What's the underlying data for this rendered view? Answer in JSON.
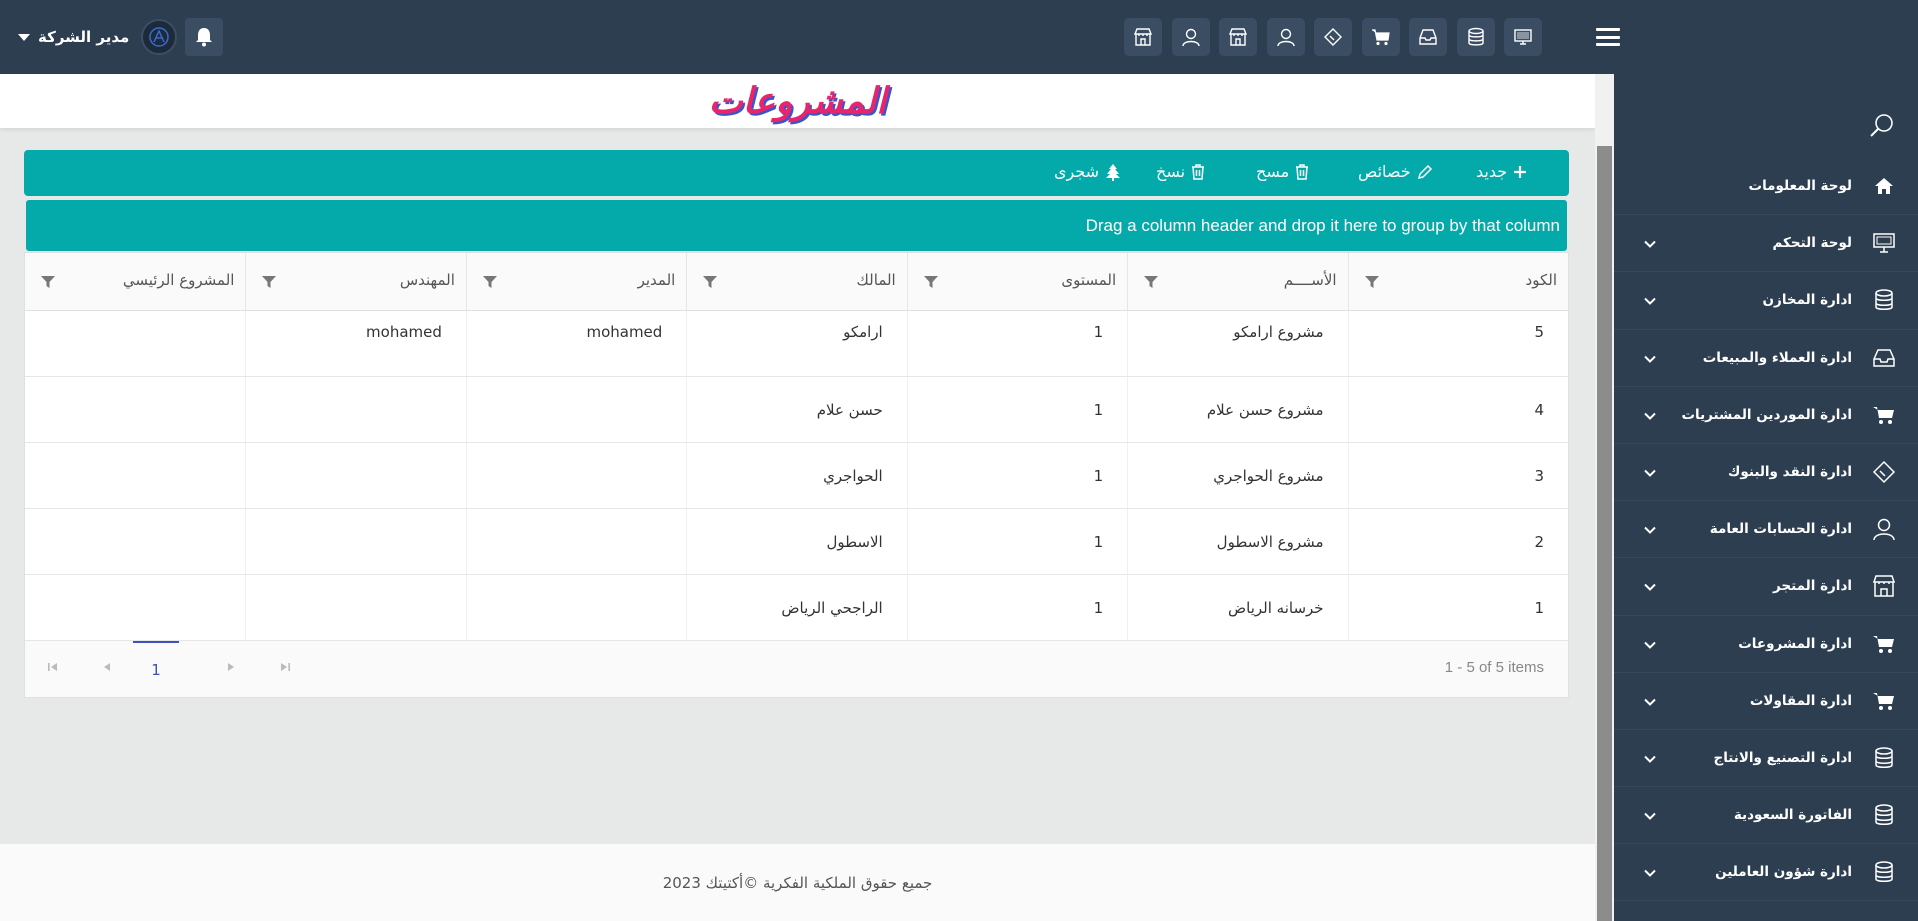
{
  "header": {
    "user_name": "مدير الشركة"
  },
  "toolbar_icons": [
    "store-icon",
    "user-icon",
    "store-icon",
    "user-icon",
    "ticket-icon",
    "cart-icon",
    "inbox-icon",
    "database-icon",
    "monitor-icon"
  ],
  "sidebar": {
    "items": [
      {
        "label": "لوحة المعلومات",
        "icon": "home-icon",
        "has_chevron": false
      },
      {
        "label": "لوحة التحكم",
        "icon": "monitor-icon",
        "has_chevron": true
      },
      {
        "label": "ادارة المخازن",
        "icon": "database-icon",
        "has_chevron": true
      },
      {
        "label": "ادارة العملاء والمبيعات",
        "icon": "inbox-icon",
        "has_chevron": true
      },
      {
        "label": "ادارة الموردين المشتريات",
        "icon": "cart-icon",
        "has_chevron": true
      },
      {
        "label": "ادارة النقد والبنوك",
        "icon": "ticket-icon",
        "has_chevron": true
      },
      {
        "label": "ادارة الحسابات العامة",
        "icon": "user-icon",
        "has_chevron": true
      },
      {
        "label": "ادارة المتجر",
        "icon": "store-icon",
        "has_chevron": true
      },
      {
        "label": "ادارة المشروعات",
        "icon": "cart-icon",
        "has_chevron": true
      },
      {
        "label": "ادارة المقاولات",
        "icon": "cart-icon",
        "has_chevron": true
      },
      {
        "label": "ادارة التصنيع والانتاج",
        "icon": "database-icon",
        "has_chevron": true
      },
      {
        "label": "الفاتورة السعودية",
        "icon": "database-icon",
        "has_chevron": true
      },
      {
        "label": "ادارة شؤون العاملين",
        "icon": "database-icon",
        "has_chevron": true
      }
    ]
  },
  "page": {
    "title": "المشروعات"
  },
  "actions": {
    "new_label": "جديد",
    "properties_label": "خصائص",
    "delete_label": "مسح",
    "copy_label": "نسخ",
    "tree_label": "شجرى"
  },
  "grid": {
    "group_hint": "Drag a column header and drop it here to group by that column",
    "columns": [
      "الكود",
      "الأســــم",
      "المستوى",
      "المالك",
      "المدير",
      "المهندس",
      "المشروع الرئيسي"
    ],
    "rows": [
      [
        "5",
        "مشروع ارامكو",
        "1",
        "ارامكو",
        "mohamed",
        "mohamed",
        ""
      ],
      [
        "4",
        "مشروع حسن علام",
        "1",
        "حسن علام",
        "",
        "",
        ""
      ],
      [
        "3",
        "مشروع الحواجري",
        "1",
        "الحواجري",
        "",
        "",
        ""
      ],
      [
        "2",
        "مشروع الاسطول",
        "1",
        "الاسطول",
        "",
        "",
        ""
      ],
      [
        "1",
        "خرسانه الرياض",
        "1",
        "الراجحي الرياض",
        "",
        "",
        ""
      ]
    ],
    "pager": {
      "current_page": "1",
      "info": "1 - 5 of 5 items"
    }
  },
  "footer": {
    "text": "جميع حقوق الملكية الفكرية ©أكتيتك 2023"
  },
  "colors": {
    "topbar": "#2c3e50",
    "accent": "#04aaaa",
    "title_pink": "#e8256c",
    "title_shadow": "#3a55c8",
    "pager_active": "#3f51b5"
  }
}
